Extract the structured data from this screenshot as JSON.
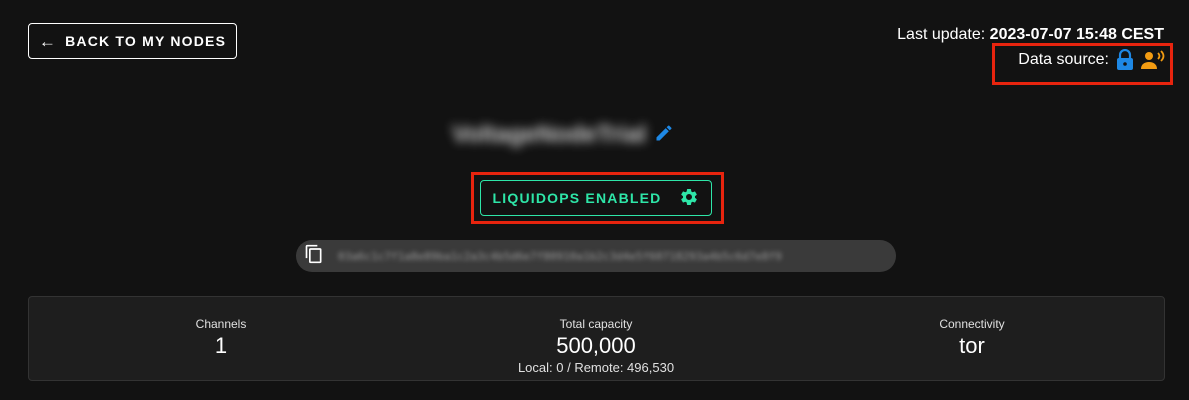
{
  "back_button": {
    "label": "BACK TO MY NODES",
    "icon": "arrow-left-icon"
  },
  "last_update": {
    "label": "Last update:",
    "value": "2023-07-07 15:48 CEST"
  },
  "data_source": {
    "label": "Data source:",
    "icons": [
      "lock-icon",
      "record-voice-icon"
    ],
    "colors": {
      "lock": "#1e88e5",
      "voice": "#f39c12"
    }
  },
  "node": {
    "name": "VoltageNodeTrial",
    "edit_icon": "edit-pencil-icon"
  },
  "liquidops": {
    "label": "LIQUIDOPS ENABLED",
    "icon": "gear-icon",
    "color": "#2ee6a8"
  },
  "pubkey": {
    "icon": "copy-icon",
    "value": "03a6c1c7f1a8e89ba1c2a3c4b5d6e7f80910a1b2c3d4e5f60718293a4b5c6d7e8f9"
  },
  "stats": {
    "channels": {
      "label": "Channels",
      "value": "1"
    },
    "capacity": {
      "label": "Total capacity",
      "value": "500,000",
      "sub": "Local: 0 / Remote: 496,530"
    },
    "connectivity": {
      "label": "Connectivity",
      "value": "tor"
    }
  }
}
